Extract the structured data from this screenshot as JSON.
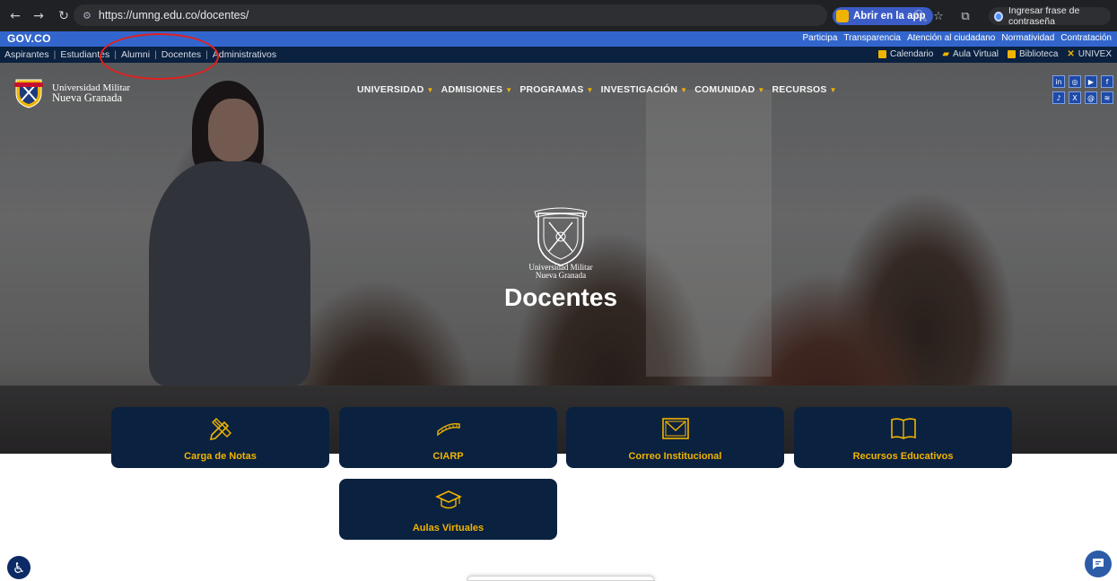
{
  "browser": {
    "url": "https://umng.edu.co/docentes/",
    "open_app_label": "Abrir en la app",
    "passphrase_label": "Ingresar frase de contraseña"
  },
  "govbar": {
    "logo": "GOV.CO",
    "links": [
      "Participa",
      "Transparencia",
      "Atención al ciudadano",
      "Normatividad",
      "Contratación"
    ]
  },
  "audience_bar": {
    "links": [
      "Aspirantes",
      "Estudiantes",
      "Alumni",
      "Docentes",
      "Administrativos"
    ],
    "tools": [
      "Calendario",
      "Aula Virtual",
      "Biblioteca",
      "UNIVEX"
    ]
  },
  "site": {
    "logo_line1": "Universidad Militar",
    "logo_line2": "Nueva Granada",
    "nav": [
      "UNIVERSIDAD",
      "ADMISIONES",
      "PROGRAMAS",
      "INVESTIGACIÓN",
      "COMUNIDAD",
      "RECURSOS"
    ],
    "social_icons": [
      "linkedin-icon",
      "instagram-icon",
      "youtube-icon",
      "facebook-icon",
      "tiktok-icon",
      "x-icon",
      "threads-icon",
      "spotify-icon"
    ]
  },
  "hero": {
    "crest_line1": "Universidad Militar",
    "crest_line2": "Nueva Granada",
    "title": "Docentes"
  },
  "cards": [
    {
      "label": "Carga de Notas",
      "icon": "pencil-ruler-icon"
    },
    {
      "label": "CIARP",
      "icon": "ruler-icon"
    },
    {
      "label": "Correo Institucional",
      "icon": "envelope-icon"
    },
    {
      "label": "Recursos Educativos",
      "icon": "book-icon"
    },
    {
      "label": "Aulas Virtuales",
      "icon": "graduation-cap-icon"
    }
  ],
  "colors": {
    "navy": "#0b2140",
    "gold": "#f0b400",
    "gov_blue": "#3366cc"
  }
}
